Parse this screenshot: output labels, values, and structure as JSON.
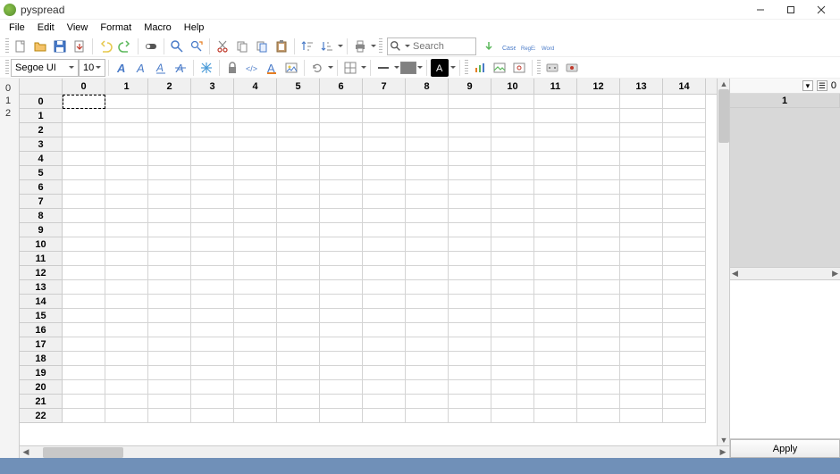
{
  "window": {
    "title": "pyspread"
  },
  "menu": {
    "items": [
      "File",
      "Edit",
      "View",
      "Format",
      "Macro",
      "Help"
    ]
  },
  "toolbar1": {
    "search_placeholder": "Search"
  },
  "toolbar2": {
    "font_name": "Segoe UI",
    "font_size": "10",
    "line_color": "#808080",
    "bg_color": "#ffffff",
    "text_color": "#000000"
  },
  "right_panel": {
    "counter": "0",
    "tab_label": "1",
    "apply_label": "Apply"
  },
  "left_tabs": [
    "0",
    "1",
    "2"
  ],
  "grid": {
    "visible_cols": [
      0,
      1,
      2,
      3,
      4,
      5,
      6,
      7,
      8,
      9,
      10,
      11,
      12,
      13,
      14
    ],
    "visible_rows": [
      0,
      1,
      2,
      3,
      4,
      5,
      6,
      7,
      8,
      9,
      10,
      11,
      12,
      13,
      14,
      15,
      16,
      17,
      18,
      19,
      20,
      21,
      22
    ],
    "cursor": {
      "row": 0,
      "col": 0
    }
  }
}
